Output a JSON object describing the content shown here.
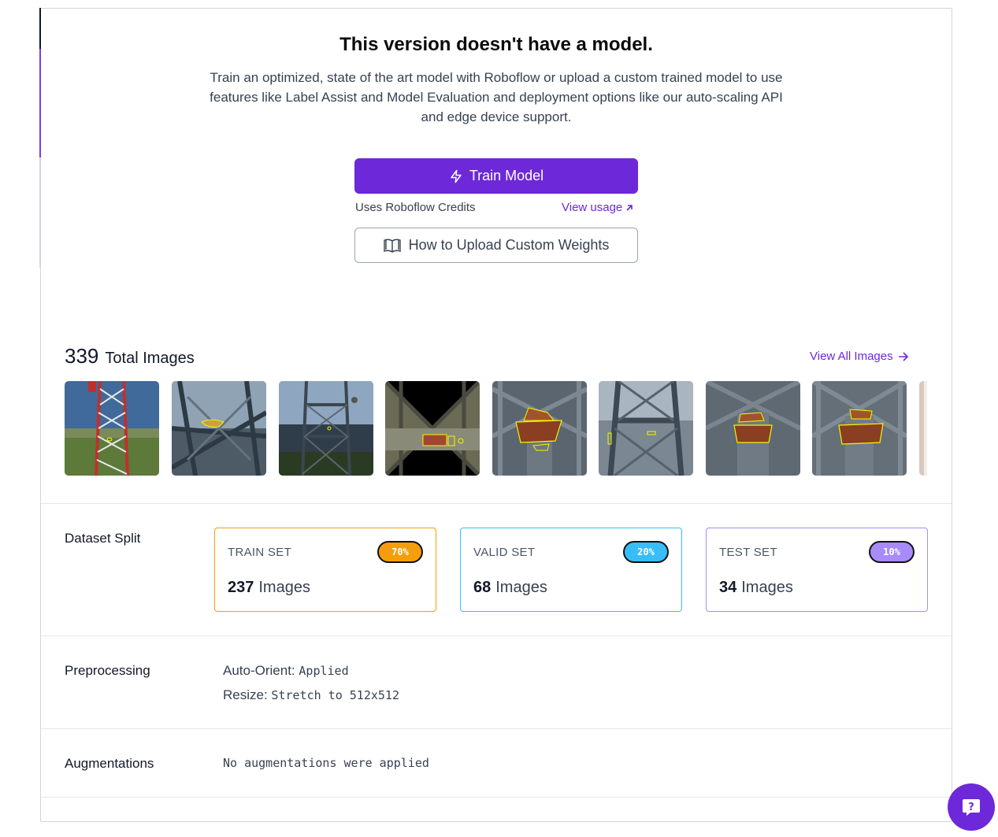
{
  "hero": {
    "title": "This version doesn't have a model.",
    "text": "Train an optimized, state of the art model with Roboflow or upload a custom trained model to use features like Label Assist and Model Evaluation and deployment options like our auto-scaling API and edge device support.",
    "train_button": "Train Model",
    "credits": "Uses Roboflow Credits",
    "view_usage": "View usage",
    "upload_button": "How to Upload Custom Weights"
  },
  "images": {
    "count": "339",
    "label": "Total Images",
    "view_all": "View All Images"
  },
  "dataset_split": {
    "label": "Dataset Split",
    "cards": [
      {
        "title": "TRAIN SET",
        "percent": "70%",
        "count": "237",
        "unit": "Images",
        "color": "#f59e0b",
        "border": "#f59e0b"
      },
      {
        "title": "VALID SET",
        "percent": "20%",
        "count": "68",
        "unit": "Images",
        "color": "#38bdf8",
        "border": "#38bdf8"
      },
      {
        "title": "TEST SET",
        "percent": "10%",
        "count": "34",
        "unit": "Images",
        "color": "#a78bfa",
        "border": "#a78bfa"
      }
    ]
  },
  "preprocessing": {
    "label": "Preprocessing",
    "items": [
      {
        "key": "Auto-Orient:",
        "value": "Applied"
      },
      {
        "key": "Resize:",
        "value": "Stretch to 512x512"
      }
    ]
  },
  "augmentations": {
    "label": "Augmentations",
    "value": "No augmentations were applied"
  },
  "colors": {
    "accent": "#6d28d9"
  }
}
